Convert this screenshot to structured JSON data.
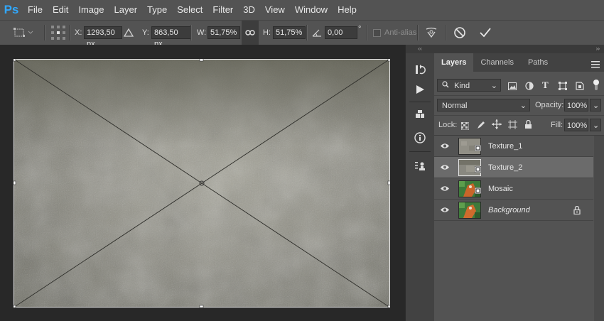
{
  "app": {
    "logo": "Ps"
  },
  "menu": [
    "File",
    "Edit",
    "Image",
    "Layer",
    "Type",
    "Select",
    "Filter",
    "3D",
    "View",
    "Window",
    "Help"
  ],
  "options": {
    "x_label": "X:",
    "x_value": "1293,50 px",
    "y_label": "Y:",
    "y_value": "863,50 px",
    "w_label": "W:",
    "w_value": "51,75%",
    "h_label": "H:",
    "h_value": "51,75%",
    "angle_value": "0,00",
    "angle_unit": "°",
    "antialias_label": "Anti-alias"
  },
  "panel": {
    "tabs": [
      {
        "label": "Layers",
        "active": true
      },
      {
        "label": "Channels",
        "active": false
      },
      {
        "label": "Paths",
        "active": false
      }
    ],
    "filter_kind": "Kind",
    "blend_mode": "Normal",
    "opacity_label": "Opacity:",
    "opacity_value": "100%",
    "lock_label": "Lock:",
    "fill_label": "Fill:",
    "fill_value": "100%",
    "layers": [
      {
        "name": "Texture_1",
        "selected": false,
        "italic": false
      },
      {
        "name": "Texture_2",
        "selected": true,
        "italic": false
      },
      {
        "name": "Mosaic",
        "selected": false,
        "italic": false
      },
      {
        "name": "Background",
        "selected": false,
        "italic": true
      }
    ]
  },
  "colors": {
    "accent": "#31a8ff",
    "ui_bg": "#535353",
    "canvas_bg": "#282828"
  }
}
